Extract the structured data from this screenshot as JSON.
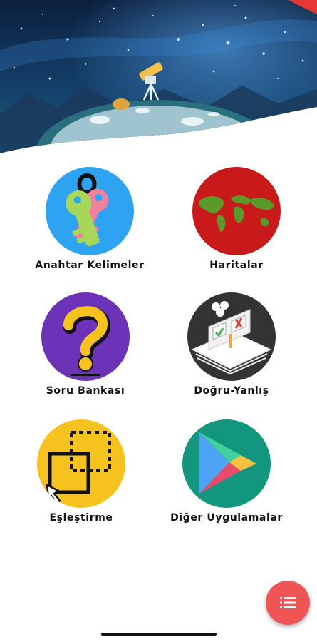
{
  "tiles": [
    {
      "label": "Anahtar Kelimeler",
      "icon": "keys-icon",
      "color": "#2ea3f2"
    },
    {
      "label": "Haritalar",
      "icon": "world-map-icon",
      "color": "#c81a1a"
    },
    {
      "label": "Soru Bankası",
      "icon": "question-mark-icon",
      "color": "#6c32b8"
    },
    {
      "label": "Doğru-Yanlış",
      "icon": "true-false-icon",
      "color": "#333333"
    },
    {
      "label": "Eşleştirme",
      "icon": "drag-match-icon",
      "color": "#f5c21e"
    },
    {
      "label": "Diğer Uygulamalar",
      "icon": "play-store-icon",
      "color": "#13967e"
    }
  ],
  "fab": {
    "icon": "list-icon",
    "color": "#f05555"
  },
  "colors": {
    "hero_sky": "#0f2a4a",
    "hero_accent": "#e53935"
  }
}
